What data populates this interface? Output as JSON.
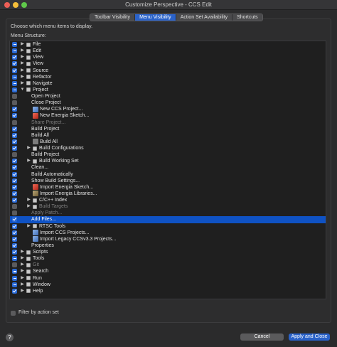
{
  "window": {
    "title": "Customize Perspective - CCS Edit"
  },
  "tabs": [
    {
      "label": "Toolbar Visibility",
      "active": false
    },
    {
      "label": "Menu Visibility",
      "active": true
    },
    {
      "label": "Action Set Availability",
      "active": false
    },
    {
      "label": "Shortcuts",
      "active": false
    }
  ],
  "instructions": "Choose which menu items to display.",
  "menu_structure_label": "Menu Structure:",
  "tree": [
    {
      "label": "File",
      "state": "mixed",
      "level": 0,
      "arrow": "right",
      "icon": "folder-icon",
      "dim": false
    },
    {
      "label": "Edit",
      "state": "mixed",
      "level": 0,
      "arrow": "right",
      "icon": "folder-icon",
      "dim": false
    },
    {
      "label": "View",
      "state": "checked",
      "level": 0,
      "arrow": "right",
      "icon": "folder-icon",
      "dim": false
    },
    {
      "label": "View",
      "state": "checked",
      "level": 0,
      "arrow": "right",
      "icon": "folder-icon",
      "dim": false
    },
    {
      "label": "Source",
      "state": "checked",
      "level": 0,
      "arrow": "right",
      "icon": "folder-icon",
      "dim": false
    },
    {
      "label": "Refactor",
      "state": "mixed",
      "level": 0,
      "arrow": "right",
      "icon": "folder-icon",
      "dim": false
    },
    {
      "label": "Navigate",
      "state": "mixed",
      "level": 0,
      "arrow": "right",
      "icon": "folder-icon",
      "dim": false
    },
    {
      "label": "Project",
      "state": "mixed",
      "level": 0,
      "arrow": "down",
      "icon": "folder-icon",
      "dim": false
    },
    {
      "label": "Open Project",
      "state": "unchecked",
      "level": 1,
      "arrow": "",
      "icon": "",
      "dim": false
    },
    {
      "label": "Close Project",
      "state": "unchecked",
      "level": 1,
      "arrow": "",
      "icon": "",
      "dim": false
    },
    {
      "label": "New CCS Project...",
      "state": "checked",
      "level": 1,
      "arrow": "",
      "icon": "ccs-project-icon",
      "dim": false
    },
    {
      "label": "New Energia Sketch...",
      "state": "checked",
      "level": 1,
      "arrow": "",
      "icon": "energia-icon",
      "dim": false
    },
    {
      "label": "Share Project...",
      "state": "unchecked",
      "level": 1,
      "arrow": "",
      "icon": "",
      "dim": true
    },
    {
      "label": "Build Project",
      "state": "checked",
      "level": 1,
      "arrow": "",
      "icon": "",
      "dim": false
    },
    {
      "label": "Build All",
      "state": "checked",
      "level": 1,
      "arrow": "",
      "icon": "",
      "dim": false
    },
    {
      "label": "Build All",
      "state": "checked",
      "level": 1,
      "arrow": "",
      "icon": "build-icon",
      "dim": false
    },
    {
      "label": "Build Configurations",
      "state": "checked",
      "level": 1,
      "arrow": "right",
      "icon": "folder-icon",
      "dim": false
    },
    {
      "label": "Build Project",
      "state": "unchecked",
      "level": 1,
      "arrow": "",
      "icon": "",
      "dim": false
    },
    {
      "label": "Build Working Set",
      "state": "checked",
      "level": 1,
      "arrow": "right",
      "icon": "folder-icon",
      "dim": false
    },
    {
      "label": "Clean...",
      "state": "checked",
      "level": 1,
      "arrow": "",
      "icon": "",
      "dim": false
    },
    {
      "label": "Build Automatically",
      "state": "checked",
      "level": 1,
      "arrow": "",
      "icon": "",
      "dim": false
    },
    {
      "label": "Show Build Settings...",
      "state": "checked",
      "level": 1,
      "arrow": "",
      "icon": "",
      "dim": false
    },
    {
      "label": "Import Energia Sketch...",
      "state": "checked",
      "level": 1,
      "arrow": "",
      "icon": "energia-icon",
      "dim": false
    },
    {
      "label": "Import Energia Libraries...",
      "state": "checked",
      "level": 1,
      "arrow": "",
      "icon": "library-icon",
      "dim": false
    },
    {
      "label": "C/C++ Index",
      "state": "checked",
      "level": 1,
      "arrow": "right",
      "icon": "folder-icon",
      "dim": false
    },
    {
      "label": "Build Targets",
      "state": "unchecked",
      "level": 1,
      "arrow": "right",
      "icon": "folder-icon",
      "dim": true
    },
    {
      "label": "Apply Patch...",
      "state": "unchecked",
      "level": 1,
      "arrow": "",
      "icon": "",
      "dim": true
    },
    {
      "label": "Add Files...",
      "state": "checked",
      "level": 1,
      "arrow": "",
      "icon": "",
      "dim": false,
      "selected": true
    },
    {
      "label": "RTSC Tools",
      "state": "checked",
      "level": 1,
      "arrow": "right",
      "icon": "folder-icon",
      "dim": false
    },
    {
      "label": "Import CCS Projects...",
      "state": "checked",
      "level": 1,
      "arrow": "",
      "icon": "ccs-project-icon",
      "dim": false
    },
    {
      "label": "Import Legacy CCSv3.3 Projects...",
      "state": "checked",
      "level": 1,
      "arrow": "",
      "icon": "ccs-project-icon",
      "dim": false
    },
    {
      "label": "Properties",
      "state": "checked",
      "level": 1,
      "arrow": "",
      "icon": "",
      "dim": false
    },
    {
      "label": "Scripts",
      "state": "checked",
      "level": 0,
      "arrow": "right",
      "icon": "folder-icon",
      "dim": false
    },
    {
      "label": "Tools",
      "state": "mixed",
      "level": 0,
      "arrow": "right",
      "icon": "folder-icon",
      "dim": false
    },
    {
      "label": "Git",
      "state": "unchecked",
      "level": 0,
      "arrow": "right",
      "icon": "folder-icon",
      "dim": true
    },
    {
      "label": "Search",
      "state": "mixed",
      "level": 0,
      "arrow": "right",
      "icon": "folder-icon",
      "dim": false
    },
    {
      "label": "Run",
      "state": "mixed",
      "level": 0,
      "arrow": "right",
      "icon": "folder-icon",
      "dim": false
    },
    {
      "label": "Window",
      "state": "mixed",
      "level": 0,
      "arrow": "right",
      "icon": "folder-icon",
      "dim": false
    },
    {
      "label": "Help",
      "state": "checked",
      "level": 0,
      "arrow": "right",
      "icon": "folder-icon",
      "dim": false
    }
  ],
  "filter": {
    "label": "Filter by action set",
    "checked": false
  },
  "help_glyph": "?",
  "buttons": {
    "cancel": "Cancel",
    "apply": "Apply and Close"
  }
}
